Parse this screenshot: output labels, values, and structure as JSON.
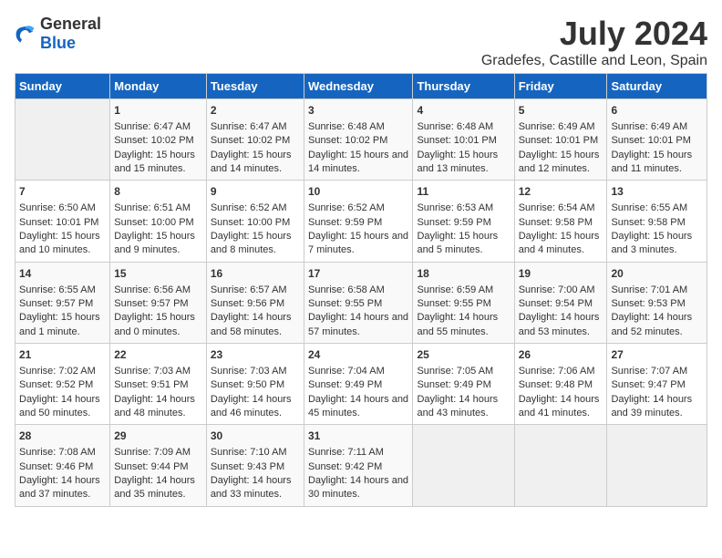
{
  "header": {
    "logo": {
      "general": "General",
      "blue": "Blue"
    },
    "title": "July 2024",
    "subtitle": "Gradefes, Castille and Leon, Spain"
  },
  "weekdays": [
    "Sunday",
    "Monday",
    "Tuesday",
    "Wednesday",
    "Thursday",
    "Friday",
    "Saturday"
  ],
  "weeks": [
    [
      {
        "day": "",
        "empty": true
      },
      {
        "day": "1",
        "sunrise": "Sunrise: 6:47 AM",
        "sunset": "Sunset: 10:02 PM",
        "daylight": "Daylight: 15 hours and 15 minutes."
      },
      {
        "day": "2",
        "sunrise": "Sunrise: 6:47 AM",
        "sunset": "Sunset: 10:02 PM",
        "daylight": "Daylight: 15 hours and 14 minutes."
      },
      {
        "day": "3",
        "sunrise": "Sunrise: 6:48 AM",
        "sunset": "Sunset: 10:02 PM",
        "daylight": "Daylight: 15 hours and 14 minutes."
      },
      {
        "day": "4",
        "sunrise": "Sunrise: 6:48 AM",
        "sunset": "Sunset: 10:01 PM",
        "daylight": "Daylight: 15 hours and 13 minutes."
      },
      {
        "day": "5",
        "sunrise": "Sunrise: 6:49 AM",
        "sunset": "Sunset: 10:01 PM",
        "daylight": "Daylight: 15 hours and 12 minutes."
      },
      {
        "day": "6",
        "sunrise": "Sunrise: 6:49 AM",
        "sunset": "Sunset: 10:01 PM",
        "daylight": "Daylight: 15 hours and 11 minutes."
      }
    ],
    [
      {
        "day": "7",
        "sunrise": "Sunrise: 6:50 AM",
        "sunset": "Sunset: 10:01 PM",
        "daylight": "Daylight: 15 hours and 10 minutes."
      },
      {
        "day": "8",
        "sunrise": "Sunrise: 6:51 AM",
        "sunset": "Sunset: 10:00 PM",
        "daylight": "Daylight: 15 hours and 9 minutes."
      },
      {
        "day": "9",
        "sunrise": "Sunrise: 6:52 AM",
        "sunset": "Sunset: 10:00 PM",
        "daylight": "Daylight: 15 hours and 8 minutes."
      },
      {
        "day": "10",
        "sunrise": "Sunrise: 6:52 AM",
        "sunset": "Sunset: 9:59 PM",
        "daylight": "Daylight: 15 hours and 7 minutes."
      },
      {
        "day": "11",
        "sunrise": "Sunrise: 6:53 AM",
        "sunset": "Sunset: 9:59 PM",
        "daylight": "Daylight: 15 hours and 5 minutes."
      },
      {
        "day": "12",
        "sunrise": "Sunrise: 6:54 AM",
        "sunset": "Sunset: 9:58 PM",
        "daylight": "Daylight: 15 hours and 4 minutes."
      },
      {
        "day": "13",
        "sunrise": "Sunrise: 6:55 AM",
        "sunset": "Sunset: 9:58 PM",
        "daylight": "Daylight: 15 hours and 3 minutes."
      }
    ],
    [
      {
        "day": "14",
        "sunrise": "Sunrise: 6:55 AM",
        "sunset": "Sunset: 9:57 PM",
        "daylight": "Daylight: 15 hours and 1 minute."
      },
      {
        "day": "15",
        "sunrise": "Sunrise: 6:56 AM",
        "sunset": "Sunset: 9:57 PM",
        "daylight": "Daylight: 15 hours and 0 minutes."
      },
      {
        "day": "16",
        "sunrise": "Sunrise: 6:57 AM",
        "sunset": "Sunset: 9:56 PM",
        "daylight": "Daylight: 14 hours and 58 minutes."
      },
      {
        "day": "17",
        "sunrise": "Sunrise: 6:58 AM",
        "sunset": "Sunset: 9:55 PM",
        "daylight": "Daylight: 14 hours and 57 minutes."
      },
      {
        "day": "18",
        "sunrise": "Sunrise: 6:59 AM",
        "sunset": "Sunset: 9:55 PM",
        "daylight": "Daylight: 14 hours and 55 minutes."
      },
      {
        "day": "19",
        "sunrise": "Sunrise: 7:00 AM",
        "sunset": "Sunset: 9:54 PM",
        "daylight": "Daylight: 14 hours and 53 minutes."
      },
      {
        "day": "20",
        "sunrise": "Sunrise: 7:01 AM",
        "sunset": "Sunset: 9:53 PM",
        "daylight": "Daylight: 14 hours and 52 minutes."
      }
    ],
    [
      {
        "day": "21",
        "sunrise": "Sunrise: 7:02 AM",
        "sunset": "Sunset: 9:52 PM",
        "daylight": "Daylight: 14 hours and 50 minutes."
      },
      {
        "day": "22",
        "sunrise": "Sunrise: 7:03 AM",
        "sunset": "Sunset: 9:51 PM",
        "daylight": "Daylight: 14 hours and 48 minutes."
      },
      {
        "day": "23",
        "sunrise": "Sunrise: 7:03 AM",
        "sunset": "Sunset: 9:50 PM",
        "daylight": "Daylight: 14 hours and 46 minutes."
      },
      {
        "day": "24",
        "sunrise": "Sunrise: 7:04 AM",
        "sunset": "Sunset: 9:49 PM",
        "daylight": "Daylight: 14 hours and 45 minutes."
      },
      {
        "day": "25",
        "sunrise": "Sunrise: 7:05 AM",
        "sunset": "Sunset: 9:49 PM",
        "daylight": "Daylight: 14 hours and 43 minutes."
      },
      {
        "day": "26",
        "sunrise": "Sunrise: 7:06 AM",
        "sunset": "Sunset: 9:48 PM",
        "daylight": "Daylight: 14 hours and 41 minutes."
      },
      {
        "day": "27",
        "sunrise": "Sunrise: 7:07 AM",
        "sunset": "Sunset: 9:47 PM",
        "daylight": "Daylight: 14 hours and 39 minutes."
      }
    ],
    [
      {
        "day": "28",
        "sunrise": "Sunrise: 7:08 AM",
        "sunset": "Sunset: 9:46 PM",
        "daylight": "Daylight: 14 hours and 37 minutes."
      },
      {
        "day": "29",
        "sunrise": "Sunrise: 7:09 AM",
        "sunset": "Sunset: 9:44 PM",
        "daylight": "Daylight: 14 hours and 35 minutes."
      },
      {
        "day": "30",
        "sunrise": "Sunrise: 7:10 AM",
        "sunset": "Sunset: 9:43 PM",
        "daylight": "Daylight: 14 hours and 33 minutes."
      },
      {
        "day": "31",
        "sunrise": "Sunrise: 7:11 AM",
        "sunset": "Sunset: 9:42 PM",
        "daylight": "Daylight: 14 hours and 30 minutes."
      },
      {
        "day": "",
        "empty": true
      },
      {
        "day": "",
        "empty": true
      },
      {
        "day": "",
        "empty": true
      }
    ]
  ]
}
